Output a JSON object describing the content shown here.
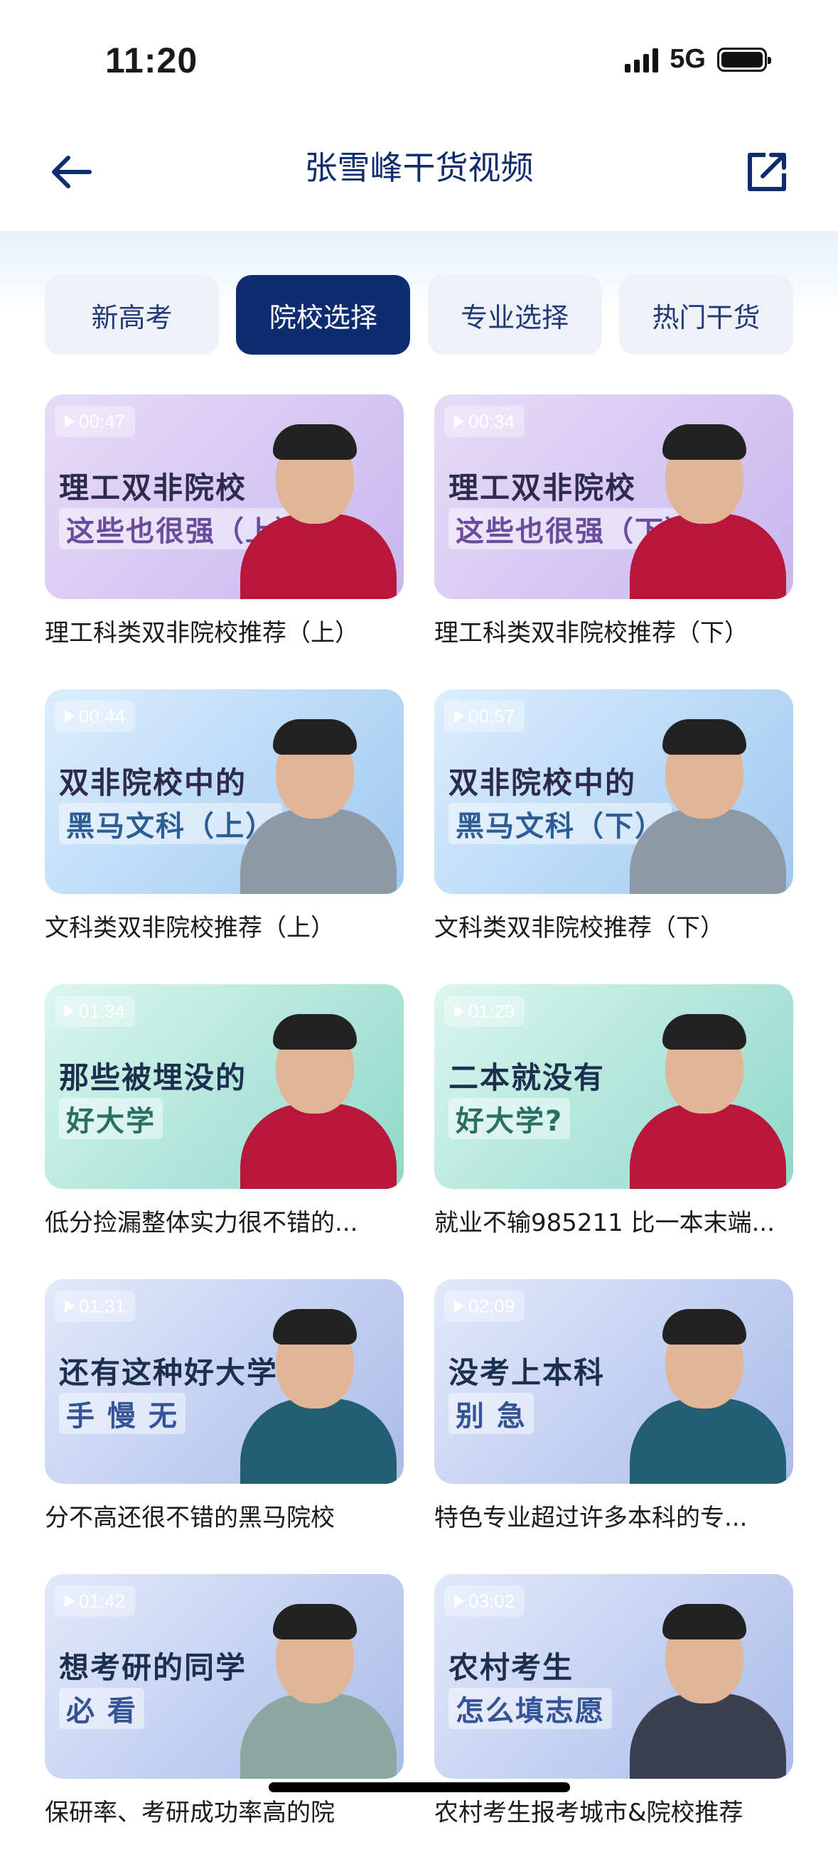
{
  "status_bar": {
    "time": "11:20",
    "network": "5G"
  },
  "nav": {
    "title": "张雪峰干货视频",
    "back_icon": "arrow-left-icon",
    "share_icon": "share-icon"
  },
  "tabs": [
    {
      "label": "新高考",
      "active": false
    },
    {
      "label": "院校选择",
      "active": true
    },
    {
      "label": "专业选择",
      "active": false
    },
    {
      "label": "热门干货",
      "active": false
    }
  ],
  "videos": [
    {
      "duration": "00:47",
      "headline": "理工双非院校",
      "subline": "这些也很强（上）",
      "theme": "purple",
      "caption": "理工科类双非院校推荐（上）"
    },
    {
      "duration": "00:34",
      "headline": "理工双非院校",
      "subline": "这些也很强（下）",
      "theme": "purple",
      "caption": "理工科类双非院校推荐（下）"
    },
    {
      "duration": "00:44",
      "headline": "双非院校中的",
      "subline": "黑马文科（上）",
      "theme": "blue",
      "caption": "文科类双非院校推荐（上）"
    },
    {
      "duration": "00:57",
      "headline": "双非院校中的",
      "subline": "黑马文科（下）",
      "theme": "blue",
      "caption": "文科类双非院校推荐（下）"
    },
    {
      "duration": "01:34",
      "headline": "那些被埋没的",
      "subline": "好大学",
      "theme": "green",
      "caption": "低分捡漏整体实力很不错的..."
    },
    {
      "duration": "01:29",
      "headline": "二本就没有",
      "subline": "好大学?",
      "theme": "green",
      "caption": "就业不输985211 比一本末端..."
    },
    {
      "duration": "01:31",
      "headline": "还有这种好大学?",
      "subline": "手 慢 无",
      "theme": "indigo",
      "caption": "分不高还很不错的黑马院校"
    },
    {
      "duration": "02:09",
      "headline": "没考上本科",
      "subline": "别 急",
      "theme": "indigo",
      "caption": "特色专业超过许多本科的专..."
    },
    {
      "duration": "01:42",
      "headline": "想考研的同学",
      "subline": "必 看",
      "theme": "indigo",
      "caption": "保研率、考研成功率高的院"
    },
    {
      "duration": "03:02",
      "headline": "农村考生",
      "subline": "怎么填志愿",
      "theme": "indigo",
      "caption": "农村考生报考城市&院校推荐"
    }
  ]
}
